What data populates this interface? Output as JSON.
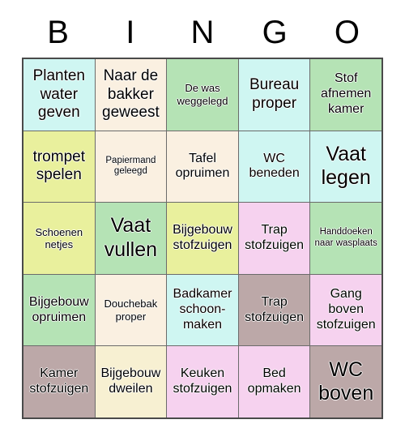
{
  "card": {
    "header_letters": [
      "B",
      "I",
      "N",
      "G",
      "O"
    ],
    "palette": {
      "light_cyan": "#CFF6F2",
      "linen": "#FAF0E1",
      "light_green": "#B5E3B5",
      "yellow_green": "#E9F09D",
      "pink": "#F6D2EF",
      "rosy_brown": "#BCA8A8",
      "cream": "#F7F0D2",
      "grid_line": "#6b6b6b",
      "text": "#000000"
    },
    "cells": [
      {
        "text": "Planten water geven",
        "color": "#CFF6F2",
        "size": "lg"
      },
      {
        "text": "Naar de bakker geweest",
        "color": "#FAF0E1",
        "size": "lg"
      },
      {
        "text": "De was weggelegd",
        "color": "#B5E3B5",
        "size": "sm"
      },
      {
        "text": "Bureau proper",
        "color": "#CFF6F2",
        "size": "lg"
      },
      {
        "text": "Stof afnemen kamer",
        "color": "#B5E3B5",
        "size": "md"
      },
      {
        "text": "trompet spelen",
        "color": "#E9F09D",
        "size": "lg"
      },
      {
        "text": "Papiermand geleegd",
        "color": "#FAF0E1",
        "size": "xs"
      },
      {
        "text": "Tafel opruimen",
        "color": "#FAF0E1",
        "size": "md"
      },
      {
        "text": "WC beneden",
        "color": "#CFF6F2",
        "size": "md"
      },
      {
        "text": "Vaat legen",
        "color": "#CFF6F2",
        "size": "xl"
      },
      {
        "text": "Schoenen netjes",
        "color": "#E9F09D",
        "size": "sm"
      },
      {
        "text": "Vaat vullen",
        "color": "#B5E3B5",
        "size": "xl"
      },
      {
        "text": "Bijgebouw stofzuigen",
        "color": "#E9F09D",
        "size": "md"
      },
      {
        "text": "Trap stofzuigen",
        "color": "#F6D2EF",
        "size": "md"
      },
      {
        "text": "Handdoeken naar wasplaats",
        "color": "#B5E3B5",
        "size": "xs"
      },
      {
        "text": "Bijgebouw opruimen",
        "color": "#B5E3B5",
        "size": "md"
      },
      {
        "text": "Douchebak proper",
        "color": "#FAF0E1",
        "size": "sm"
      },
      {
        "text": "Badkamer schoon- maken",
        "color": "#CFF6F2",
        "size": "md"
      },
      {
        "text": "Trap stofzuigen",
        "color": "#BCA8A8",
        "size": "md"
      },
      {
        "text": "Gang boven stofzuigen",
        "color": "#F6D2EF",
        "size": "md"
      },
      {
        "text": "Kamer stofzuigen",
        "color": "#BCA8A8",
        "size": "md"
      },
      {
        "text": "Bijgebouw dweilen",
        "color": "#F7F0D2",
        "size": "md"
      },
      {
        "text": "Keuken stofzuigen",
        "color": "#F6D2EF",
        "size": "md"
      },
      {
        "text": "Bed opmaken",
        "color": "#F6D2EF",
        "size": "md"
      },
      {
        "text": "WC boven",
        "color": "#BCA8A8",
        "size": "xl"
      }
    ]
  }
}
